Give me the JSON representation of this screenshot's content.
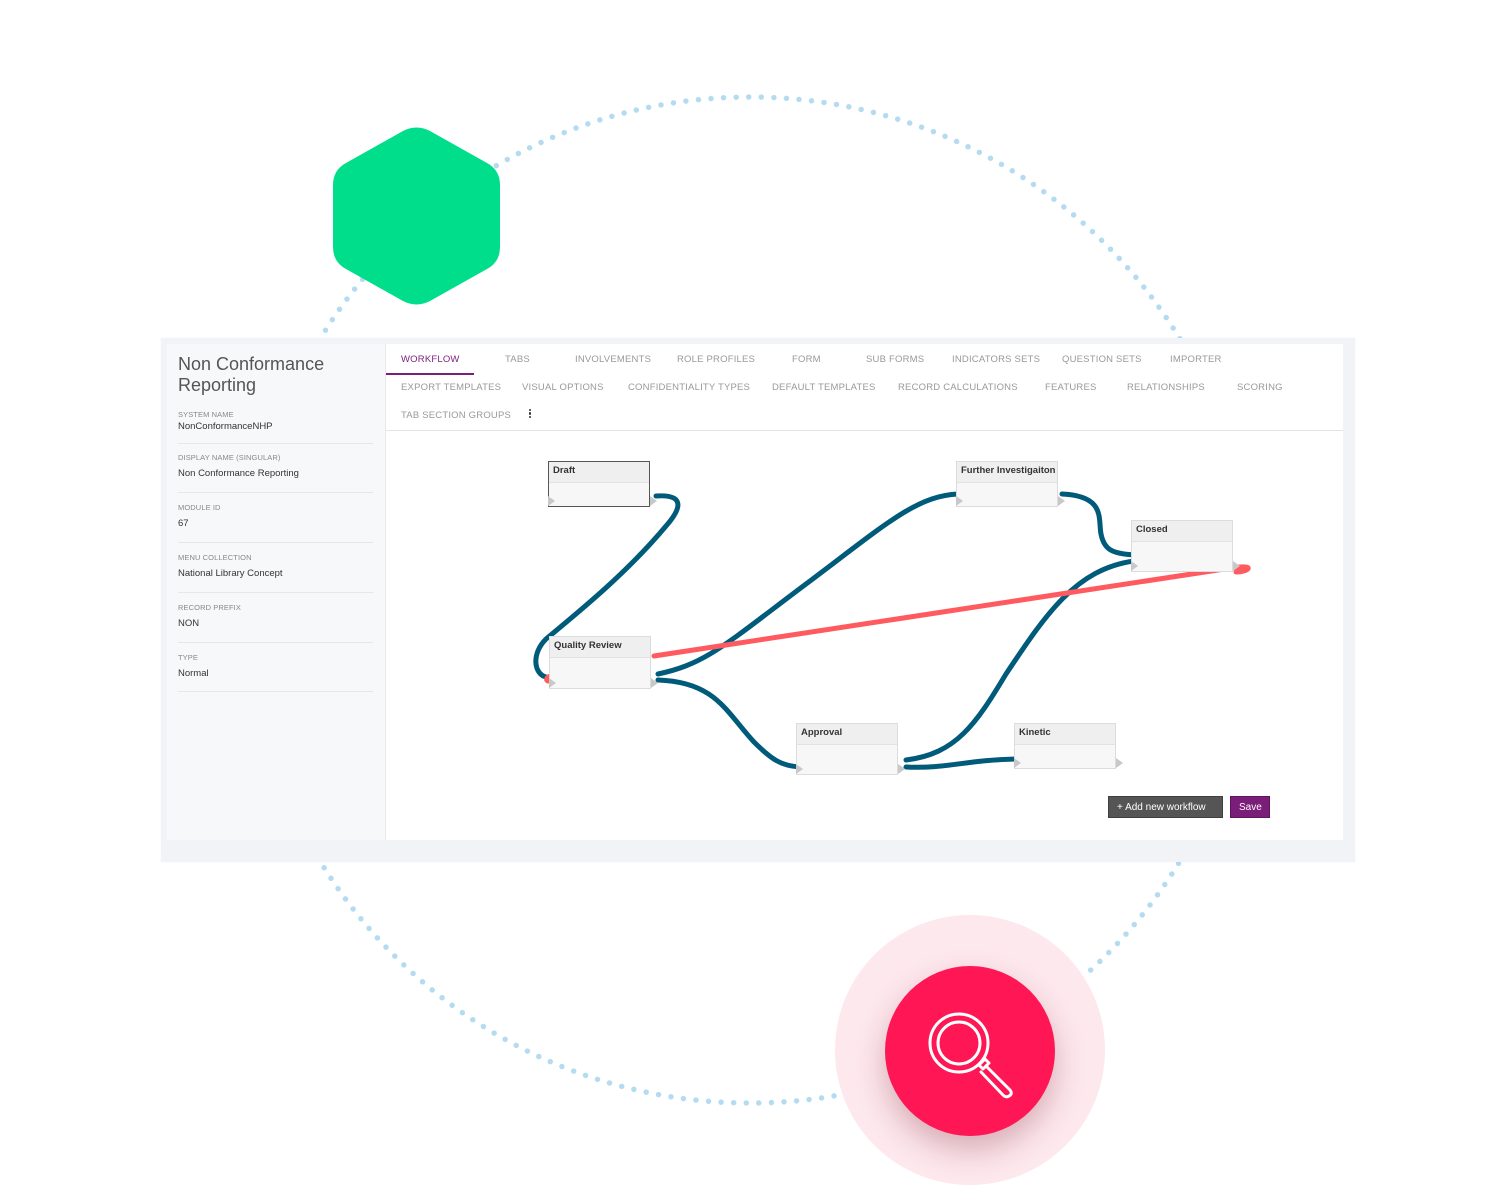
{
  "decoration": {
    "hexagon_color": "#00de8b",
    "dot_color": "#b5dbf0",
    "search_badge_color": "#ff1654",
    "search_halo_color": "#fde8ed",
    "search_icon": "magnifier-icon"
  },
  "sidebar": {
    "title": "Non Conformance Reporting",
    "fields": [
      {
        "label": "SYSTEM NAME",
        "value": "NonConformanceNHP"
      },
      {
        "label": "DISPLAY NAME (SINGULAR)",
        "value": "Non Conformance Reporting"
      },
      {
        "label": "MODULE ID",
        "value": "67"
      },
      {
        "label": "MENU COLLECTION",
        "value": "National Library Concept"
      },
      {
        "label": "RECORD PREFIX",
        "value": "NON"
      },
      {
        "label": "TYPE",
        "value": "Normal"
      }
    ]
  },
  "tabs": [
    {
      "label": "WORKFLOW",
      "active": true
    },
    {
      "label": "TABS"
    },
    {
      "label": "INVOLVEMENTS"
    },
    {
      "label": "ROLE PROFILES"
    },
    {
      "label": "FORM"
    },
    {
      "label": "SUB FORMS"
    },
    {
      "label": "INDICATORS SETS"
    },
    {
      "label": "QUESTION SETS"
    },
    {
      "label": "IMPORTER"
    },
    {
      "label": "EXPORT TEMPLATES"
    },
    {
      "label": "VISUAL OPTIONS"
    },
    {
      "label": "CONFIDENTIALITY TYPES"
    },
    {
      "label": "DEFAULT TEMPLATES"
    },
    {
      "label": "RECORD CALCULATIONS"
    },
    {
      "label": "FEATURES"
    },
    {
      "label": "RELATIONSHIPS"
    },
    {
      "label": "SCORING"
    },
    {
      "label": "TAB SECTION GROUPS"
    }
  ],
  "more_menu_icon": "kebab-vertical-icon",
  "workflow": {
    "link_color": "#005a7a",
    "highlight_link_color": "#ff5a5f",
    "nodes": [
      {
        "id": "draft",
        "label": "Draft",
        "selected": true
      },
      {
        "id": "further",
        "label": "Further Investigaiton"
      },
      {
        "id": "closed",
        "label": "Closed"
      },
      {
        "id": "quality",
        "label": "Quality Review"
      },
      {
        "id": "approval",
        "label": "Approval"
      },
      {
        "id": "kinetic",
        "label": "Kinetic"
      }
    ],
    "links": [
      {
        "from": "draft",
        "to": "quality",
        "color": "blue"
      },
      {
        "from": "quality",
        "to": "further",
        "color": "blue"
      },
      {
        "from": "quality",
        "to": "approval",
        "color": "blue"
      },
      {
        "from": "further",
        "to": "closed",
        "color": "blue"
      },
      {
        "from": "approval",
        "to": "closed",
        "color": "blue"
      },
      {
        "from": "approval",
        "to": "kinetic",
        "color": "blue"
      },
      {
        "from": "closed",
        "to": "quality",
        "color": "red"
      }
    ]
  },
  "actions": {
    "add_label": "+ Add new workflow",
    "save_label": "Save"
  }
}
